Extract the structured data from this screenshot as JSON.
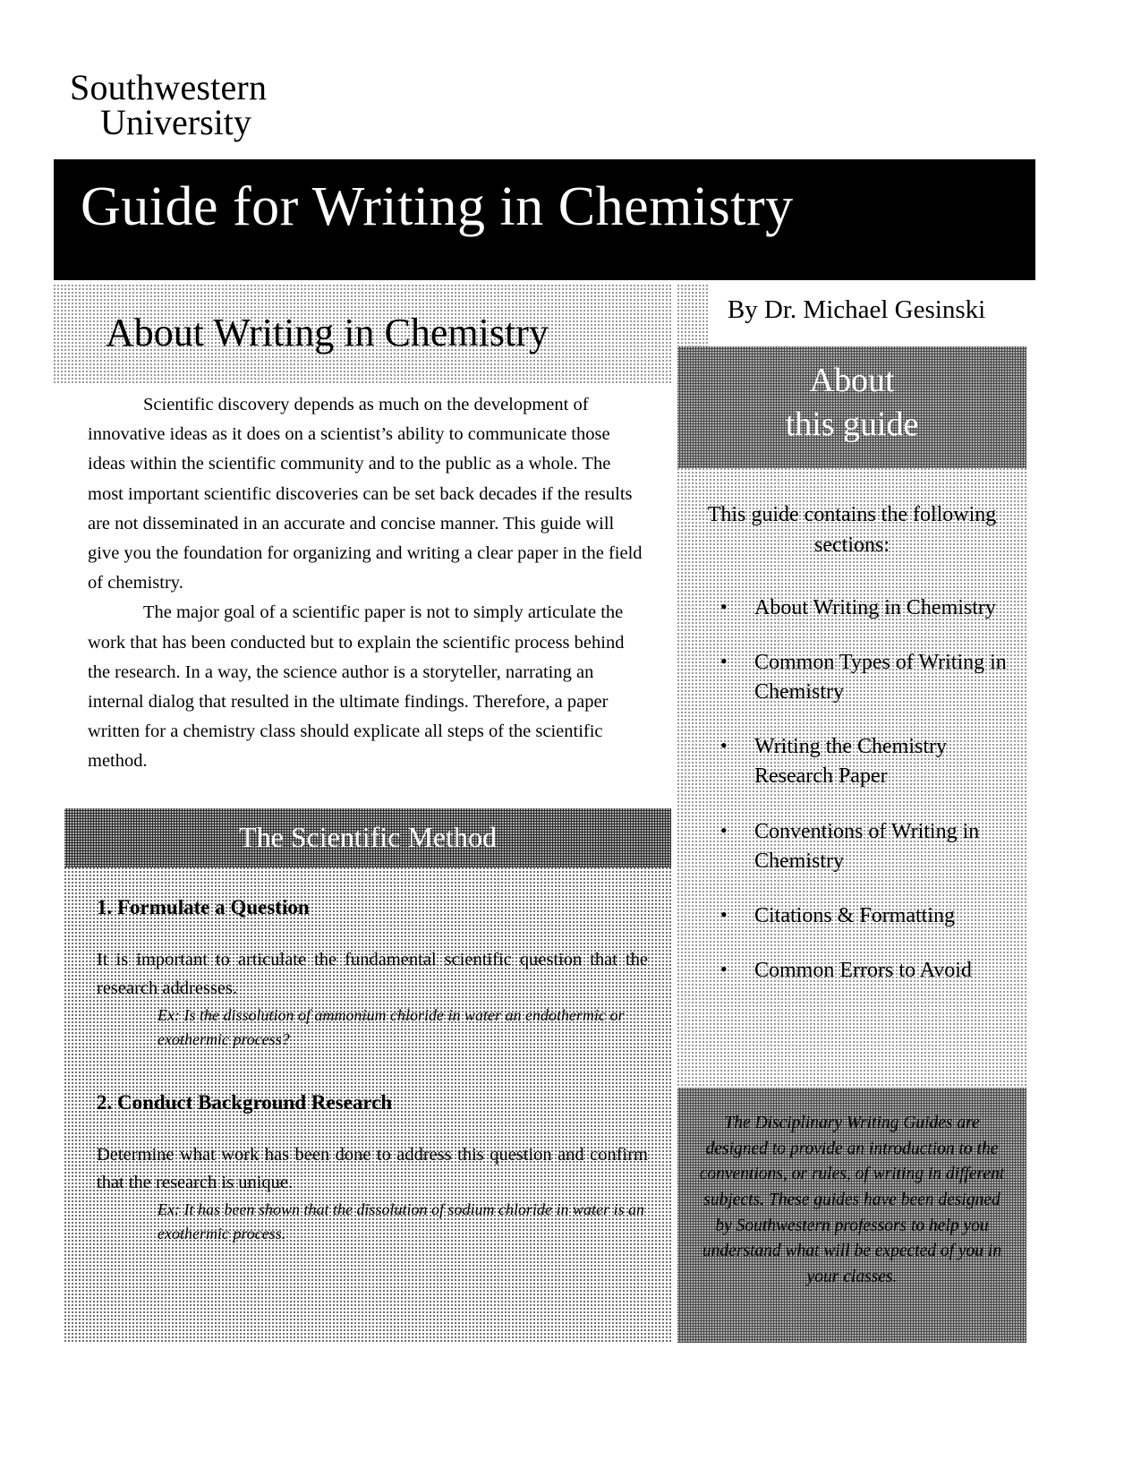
{
  "institution": {
    "line1": "Southwestern",
    "line2": "University"
  },
  "header": {
    "title": "Guide for Writing in Chemistry",
    "byline": "By Dr. Michael Gesinski"
  },
  "about_section": {
    "heading": "About Writing in Chemistry",
    "paragraphs": [
      "Scientific discovery depends as much on the development of innovative ideas as it does on a scientist’s ability to communicate those ideas within the scientific community and to the public as a whole. The most important scientific discoveries can be set back decades if the results are not disseminated in an accurate and concise manner. This guide will give you the foundation for organizing and writing a clear paper in the field of chemistry.",
      "The major goal of a scientific paper is not to simply articulate the work that has been conducted but to explain the scientific process behind the research. In a way, the science author is a storyteller, narrating an internal dialog that resulted in the ultimate findings. Therefore, a paper written for a chemistry class should explicate all steps of the scientific method."
    ]
  },
  "scientific_method": {
    "heading": "The Scientific Method",
    "steps": [
      {
        "title": "1. Formulate a Question",
        "body": "It is important to articulate the fundamental scientific question that the research addresses.",
        "example": "Ex: Is the dissolution of ammonium chloride in water an endothermic or exothermic process?"
      },
      {
        "title": "2. Conduct Background Research",
        "body": "Determine what work has been done to address this question and confirm that the research is unique.",
        "example": "Ex: It has been shown that the dissolution of sodium chloride in water is an exothermic process."
      }
    ]
  },
  "sidebar": {
    "heading_line1": "About",
    "heading_line2": "this guide",
    "intro": "This guide contains the following sections:",
    "bullet_glyph": "•",
    "sections": [
      "About Writing in Chemistry",
      "Common Types of Writing in Chemistry",
      "Writing the Chemistry Research Paper",
      "Conventions of Writing in Chemistry",
      "Citations & Formatting",
      "Common Errors to Avoid"
    ],
    "disclaimer": "The Disciplinary Writing Guides are designed to provide an introduction to the conventions, or rules, of writing in different subjects. These guides have been designed by Southwestern professors to help you understand what will be expected of you in your classes."
  },
  "colors": {
    "title_bar": "#000000",
    "title_text": "#ffffff",
    "band_dark": "#3a3a3a",
    "page_bg": "#ffffff"
  }
}
